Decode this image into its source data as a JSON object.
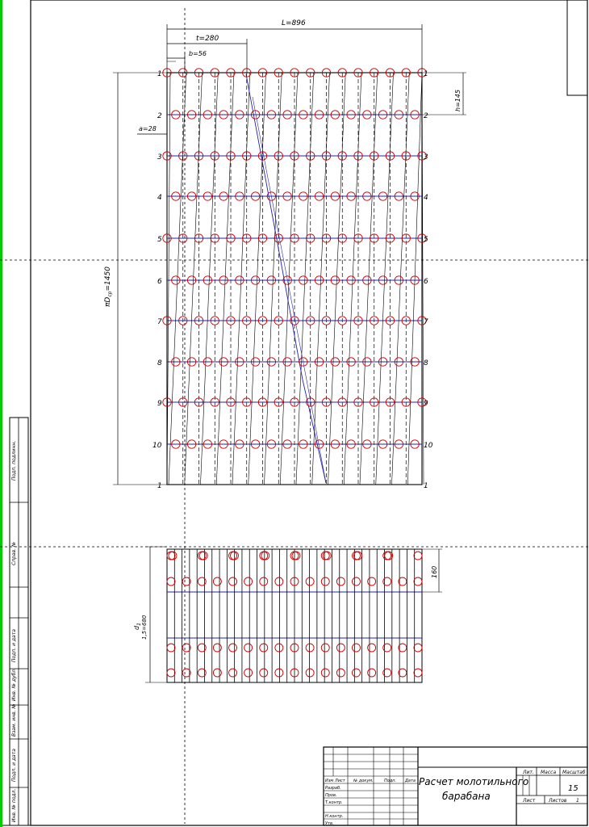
{
  "top_dims": {
    "L": "L=896",
    "t": "t=280",
    "b": "b=56",
    "a": "a=28",
    "h": "h=145",
    "circ": "πD",
    "circ_sub": "ср",
    "circ_val": "=1450"
  },
  "row_labels_left": [
    "1",
    "2",
    "3",
    "4",
    "5",
    "6",
    "7",
    "8",
    "9",
    "10",
    "1"
  ],
  "row_labels_right": [
    "1",
    "2",
    "3",
    "4",
    "5",
    "6",
    "7",
    "8",
    "9",
    "10",
    "1"
  ],
  "bottom_dims": {
    "pitch": "160",
    "height_top": "d",
    "height_sub": "1",
    "height_bottom": "1,5",
    "height_val": "=680"
  },
  "side_stamp": [
    "Подп. подлинн.",
    "Справ. №",
    "Подп. и дата",
    "Инв. № дубл.",
    "Взам. инв. №",
    "Подп. и дата",
    "Инв. № подл."
  ],
  "title_block": {
    "title_line1": "Расчет молотильного",
    "title_line2": "барабана",
    "col_headers": [
      "Изм",
      "Лист",
      "№ докум.",
      "Подп.",
      "Дата"
    ],
    "row_roles": [
      "Разраб.",
      "Пров.",
      "Т.контр.",
      "",
      "Н.контр.",
      "Утв."
    ],
    "lit_label": "Лит.",
    "mass_label": "Масса",
    "scale_label": "Масштаб",
    "scale_value": "15",
    "sheet_label": "Лист",
    "sheets_label": "Листов",
    "sheets_value": "1"
  },
  "colors": {
    "line": "#000000",
    "circle": "#cc0000",
    "accent_line": "#2222aa",
    "frame_green": "#00cc00"
  }
}
